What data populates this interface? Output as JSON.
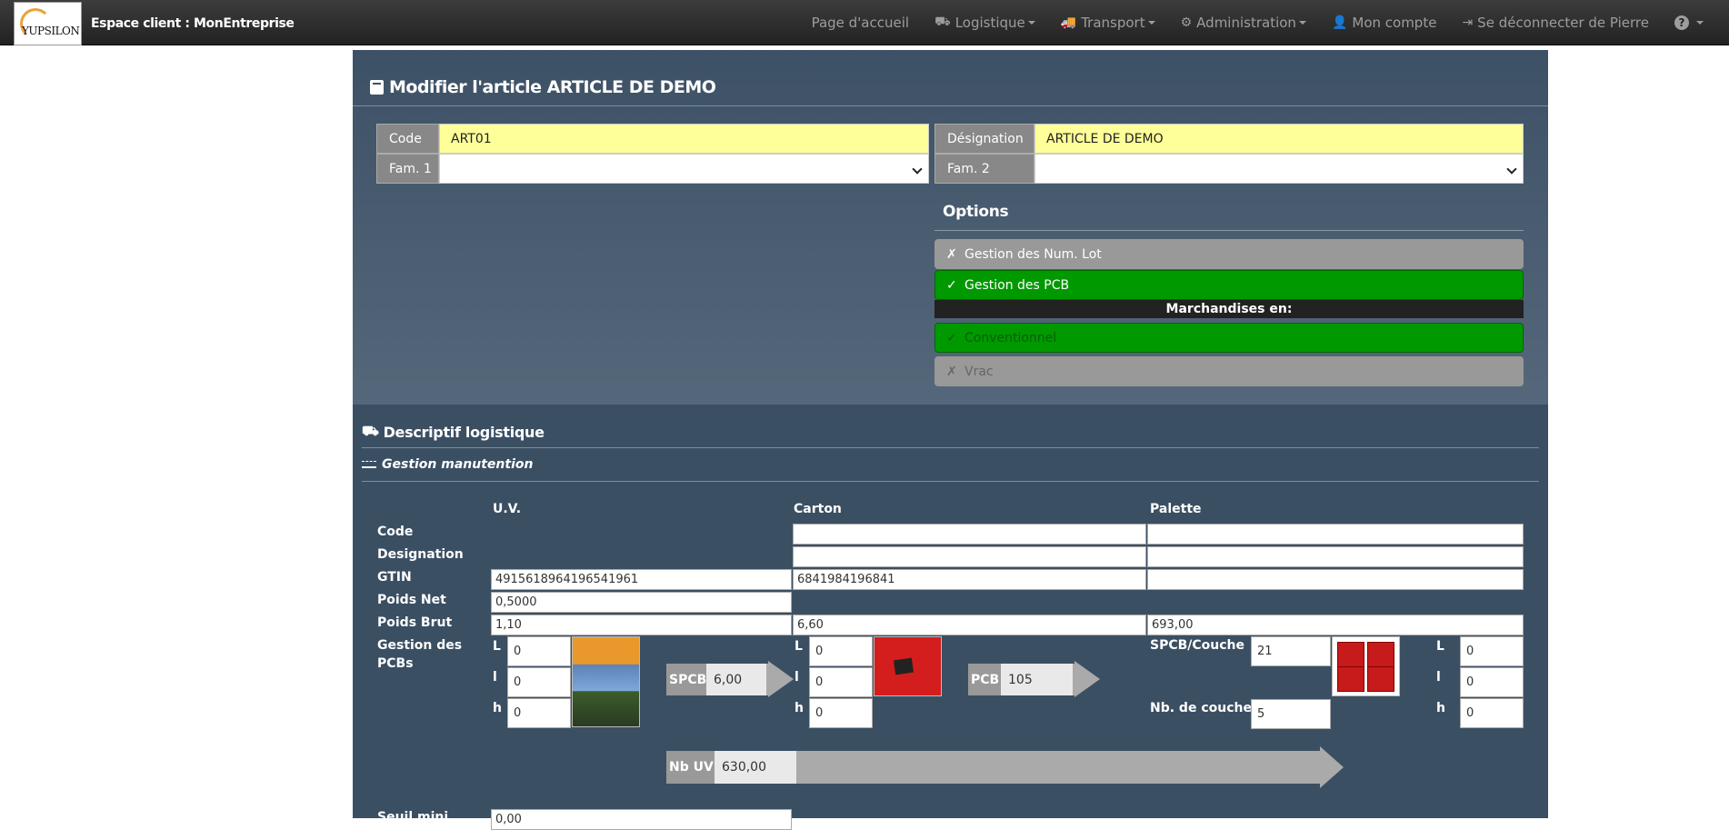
{
  "navbar": {
    "logo_text": "YUPSILON",
    "brand": "Espace client : MonEntreprise",
    "items": [
      {
        "label": "Page d'accueil"
      },
      {
        "label": "Logistique"
      },
      {
        "label": "Transport"
      },
      {
        "label": "Administration"
      },
      {
        "label": "Mon compte"
      },
      {
        "label": "Se déconnecter de Pierre"
      },
      {
        "label": "?"
      }
    ]
  },
  "form": {
    "title": "Modifier l'article ARTICLE DE DEMO",
    "code_label": "Code",
    "code_value": "ART01",
    "designation_label": "Désignation",
    "designation_value": "ARTICLE DE DEMO",
    "fam1_label": "Fam. 1",
    "fam1_value": "",
    "fam2_label": "Fam. 2",
    "fam2_value": "",
    "options_heading": "Options",
    "options": [
      {
        "mark": "✗",
        "label": "Gestion des Num. Lot"
      },
      {
        "mark": "✓",
        "label": "Gestion des PCB"
      }
    ],
    "merch_heading": "Marchandises en:",
    "merch": [
      {
        "mark": "✓",
        "label": "Conventionnel"
      },
      {
        "mark": "✗",
        "label": "Vrac"
      }
    ]
  },
  "logistics": {
    "section_title": "Descriptif logistique",
    "subsection_title": "Gestion manutention",
    "columns": {
      "uv": "U.V.",
      "carton": "Carton",
      "palette": "Palette"
    },
    "rows": {
      "code": "Code",
      "designation": "Designation",
      "gtin": "GTIN",
      "poids_net": "Poids Net",
      "poids_brut": "Poids Brut",
      "pcb_1": "Gestion des",
      "pcb_2": "PCBs",
      "seuil": "Seuil mini"
    },
    "values": {
      "uv_gtin": "4915618964196541961",
      "carton_gtin": "6841984196841",
      "uv_poids_net": "0,5000",
      "uv_poids_brut": "1,10",
      "carton_poids_brut": "6,60",
      "palette_poids_brut": "693,00",
      "uv_dims": {
        "L": "0",
        "l": "0",
        "h": "0"
      },
      "carton_dims": {
        "L": "0",
        "l": "0",
        "h": "0"
      },
      "palette_dims": {
        "L": "0",
        "l": "0",
        "h": "0"
      },
      "spcb_couche_label": "SPCB/Couche",
      "spcb_couche": "21",
      "nb_couches_label": "Nb. de couches",
      "nb_couches": "5",
      "spcb_tag": "SPCB",
      "spcb_value": "6,00",
      "pcb_tag": "PCB",
      "pcb_value": "105",
      "nbuv_tag": "Nb UV",
      "nbuv_value": "630,00",
      "seuil_value": "0,00"
    },
    "dim_labels": {
      "L": "L",
      "l": "l",
      "h": "h"
    }
  },
  "colors": {
    "panel": "#3b4f63",
    "field_yellow": "#ffff99",
    "option_green": "#009900",
    "option_grey": "#999999",
    "arrow_grey": "#aaaaaa"
  },
  "icons": [
    "home-icon",
    "dolly-icon",
    "truck-icon",
    "gear-icon",
    "user-icon",
    "sign-out-icon",
    "help-icon",
    "box-icon"
  ]
}
